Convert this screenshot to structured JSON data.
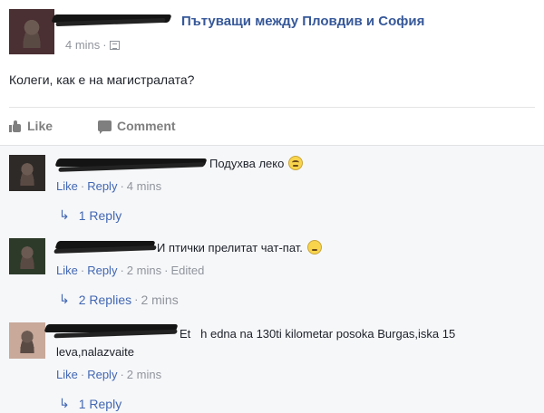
{
  "post": {
    "group_name": "Пътуващи между Пловдив и София",
    "time": "4 mins",
    "privacy_icon": "audience-icon",
    "text": "Колеги, как е на магистралата?",
    "like_label": "Like",
    "comment_label": "Comment"
  },
  "comments": [
    {
      "text": "Подухва леко",
      "emoji": "grinning-emoji",
      "like": "Like",
      "reply": "Reply",
      "time": "4 mins",
      "edited": "",
      "replies": "1 Reply",
      "replies_time": ""
    },
    {
      "text": "И птички прелитат чат-пат.",
      "emoji": "smile-emoji",
      "like": "Like",
      "reply": "Reply",
      "time": "2 mins",
      "edited": "Edited",
      "replies": "2 Replies",
      "replies_time": "2 mins"
    },
    {
      "text_line1": "Et   h edna na 130ti kilometar posoka Burgas,iska 15",
      "text_line2": "leva,nalazvaite",
      "like": "Like",
      "reply": "Reply",
      "time": "2 mins",
      "replies": "1 Reply"
    }
  ],
  "colors": {
    "link": "#365899",
    "action_link": "#4267b2",
    "meta": "#90949c",
    "comments_bg": "#f6f7f9"
  }
}
